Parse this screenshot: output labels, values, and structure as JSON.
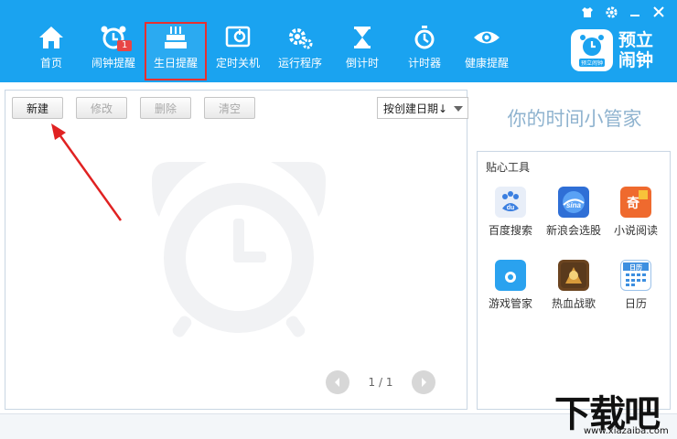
{
  "window": {
    "controls": [
      "skin-icon",
      "settings-icon",
      "minimize-icon",
      "close-icon"
    ]
  },
  "nav": [
    {
      "label": "首页",
      "icon": "home-icon"
    },
    {
      "label": "闹钟提醒",
      "icon": "alarm-icon",
      "badge": "1"
    },
    {
      "label": "生日提醒",
      "icon": "cake-icon",
      "active": true
    },
    {
      "label": "定时关机",
      "icon": "power-icon"
    },
    {
      "label": "运行程序",
      "icon": "gears-icon"
    },
    {
      "label": "倒计时",
      "icon": "hourglass-icon"
    },
    {
      "label": "计时器",
      "icon": "stopwatch-icon"
    },
    {
      "label": "健康提醒",
      "icon": "eye-icon"
    }
  ],
  "brand": {
    "name_line1": "预立",
    "name_line2": "闹钟",
    "logo_caption": "预立闹钟",
    "color": "#1aa3f0"
  },
  "toolbar": {
    "new_label": "新建",
    "edit_label": "修改",
    "delete_label": "删除",
    "clear_label": "清空",
    "sort_label": "按创建日期↓"
  },
  "pager": {
    "text": "1 / 1"
  },
  "slogan": "你的时间小管家",
  "tools": {
    "title": "贴心工具",
    "items": [
      {
        "label": "百度搜索",
        "icon": "baidu-icon",
        "glyph": "du",
        "color": "#3b7fe0"
      },
      {
        "label": "新浪会选股",
        "icon": "sina-stock-icon",
        "glyph": "sina",
        "color": "#2f6fd6"
      },
      {
        "label": "小说阅读",
        "icon": "novel-icon",
        "glyph": "奇",
        "color": "#ef6a2e"
      },
      {
        "label": "游戏管家",
        "icon": "game-manager-icon",
        "glyph": "▶",
        "color": "#2aa2ef"
      },
      {
        "label": "热血战歌",
        "icon": "game-warsong-icon",
        "glyph": "⚔",
        "color": "#8a5a2c"
      },
      {
        "label": "日历",
        "icon": "calendar-icon",
        "glyph": "日历",
        "color": "#3d8fe0"
      }
    ]
  },
  "site_mark": {
    "text_big": "下载吧",
    "text_small": "www.xiazaiba.com"
  }
}
